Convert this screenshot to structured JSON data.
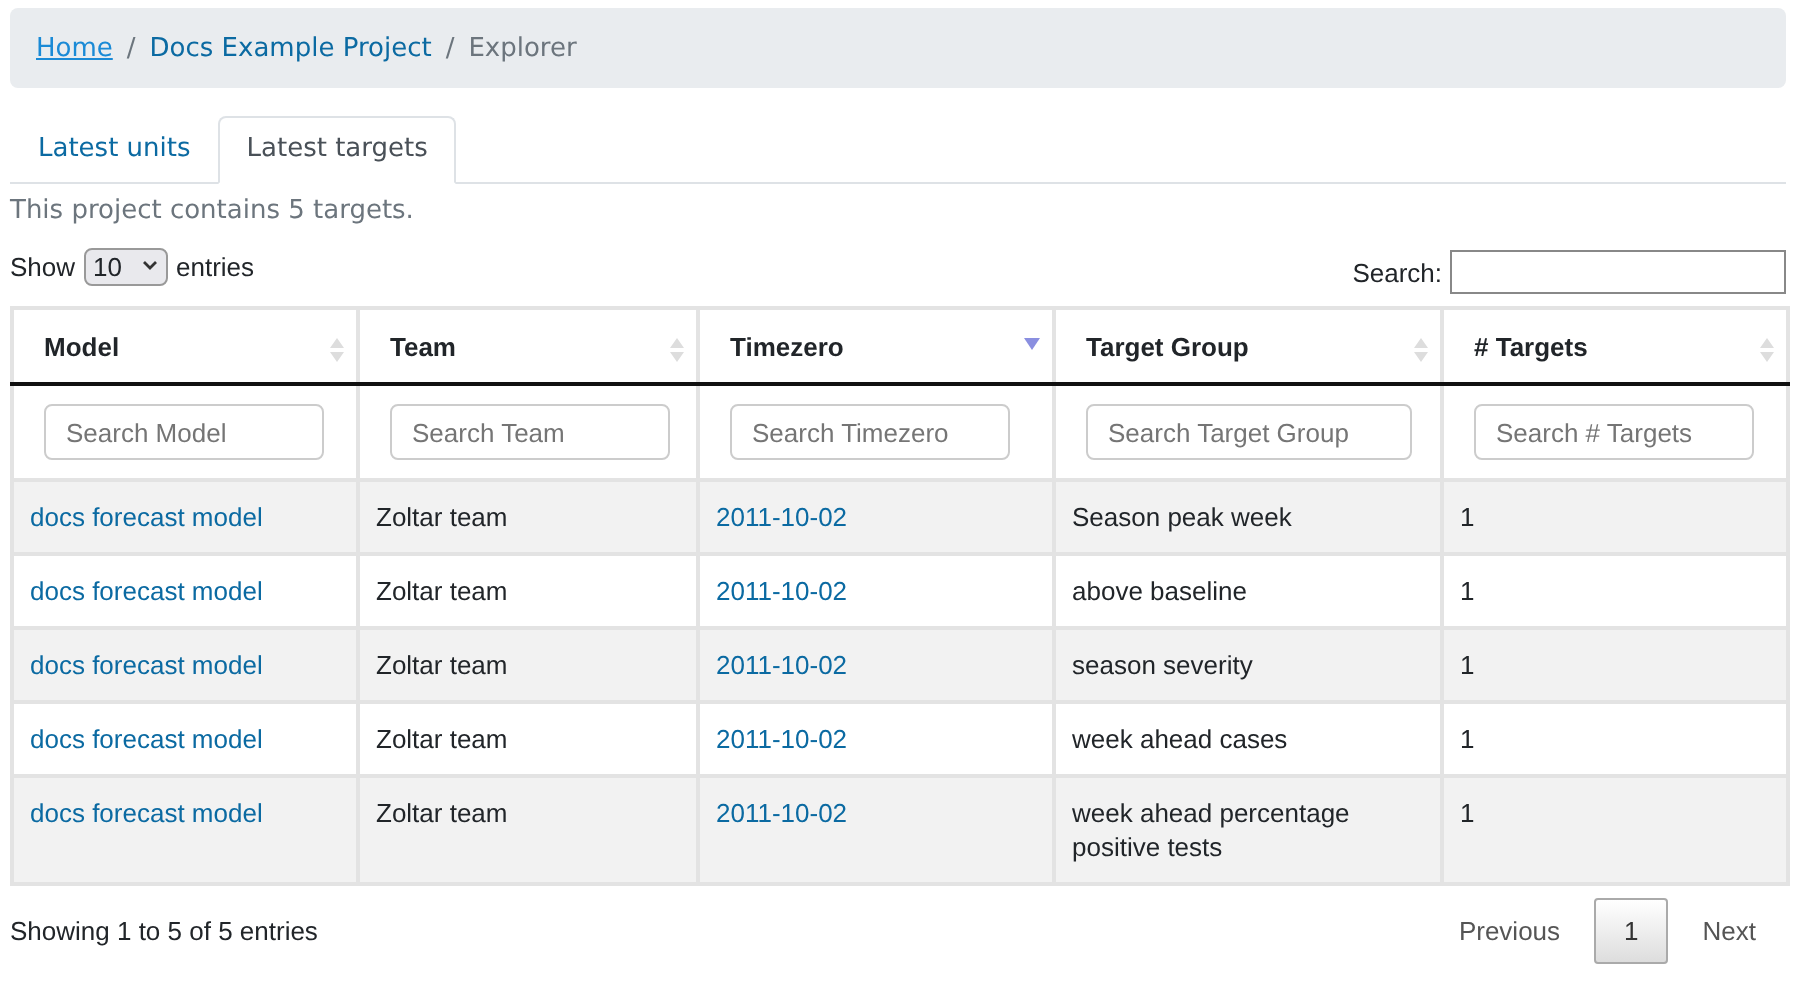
{
  "breadcrumb_separator": "/",
  "breadcrumb": [
    {
      "label": "Home",
      "kind": "underlined-link"
    },
    {
      "label": "Docs Example Project",
      "kind": "link"
    },
    {
      "label": "Explorer",
      "kind": "current"
    }
  ],
  "tabs": [
    {
      "label": "Latest units",
      "selected": false
    },
    {
      "label": "Latest targets",
      "selected": true
    }
  ],
  "summary": "This project contains 5 targets.",
  "length_menu": {
    "before": "Show",
    "value": "10",
    "after": "entries"
  },
  "search": {
    "label": "Search:"
  },
  "table": {
    "columns": [
      {
        "label": "Model",
        "sorted": false,
        "kind": "link",
        "placeholder": "Search Model"
      },
      {
        "label": "Team",
        "sorted": false,
        "kind": "text",
        "placeholder": "Search Team"
      },
      {
        "label": "Timezero",
        "sorted": true,
        "kind": "link",
        "placeholder": "Search Timezero"
      },
      {
        "label": "Target Group",
        "sorted": false,
        "kind": "text",
        "placeholder": "Search Target Group"
      },
      {
        "label": "# Targets",
        "sorted": false,
        "kind": "text",
        "placeholder": "Search # Targets"
      }
    ],
    "rows": [
      [
        "docs forecast model",
        "Zoltar team",
        "2011-10-02",
        "Season peak week",
        "1"
      ],
      [
        "docs forecast model",
        "Zoltar team",
        "2011-10-02",
        "above baseline",
        "1"
      ],
      [
        "docs forecast model",
        "Zoltar team",
        "2011-10-02",
        "season severity",
        "1"
      ],
      [
        "docs forecast model",
        "Zoltar team",
        "2011-10-02",
        "week ahead cases",
        "1"
      ],
      [
        "docs forecast model",
        "Zoltar team",
        "2011-10-02",
        "week ahead percentage positive tests",
        "1"
      ]
    ]
  },
  "info": "Showing 1 to 5 of 5 entries",
  "pagination": [
    {
      "label": "Previous",
      "selected": false
    },
    {
      "label": "1",
      "selected": true
    },
    {
      "label": "Next",
      "selected": false
    }
  ]
}
